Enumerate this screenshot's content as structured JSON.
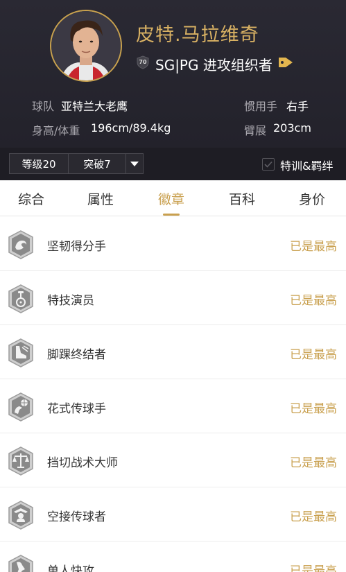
{
  "player": {
    "name": "皮特.马拉维奇",
    "overall": "70",
    "position_role": "SG|PG 进攻组织者"
  },
  "info": {
    "team_label": "球队",
    "team_value": "亚特兰大老鹰",
    "hand_label": "惯用手",
    "hand_value": "右手",
    "height_weight_label": "身高/体重",
    "height_weight_value": "196cm/89.4kg",
    "wingspan_label": "臂展",
    "wingspan_value": "203cm"
  },
  "controls": {
    "level": "等级20",
    "breakthrough": "突破7",
    "training_label": "特训&羁绊"
  },
  "tabs": [
    {
      "label": "综合"
    },
    {
      "label": "属性"
    },
    {
      "label": "徽章"
    },
    {
      "label": "百科"
    },
    {
      "label": "身价"
    }
  ],
  "active_tab": "徽章",
  "badges": [
    {
      "name": "坚韧得分手",
      "status": "已是最高",
      "icon": "tough-scorer-icon"
    },
    {
      "name": "特技演员",
      "status": "已是最高",
      "icon": "unicycle-icon"
    },
    {
      "name": "脚踝终结者",
      "status": "已是最高",
      "icon": "ankle-breaker-icon"
    },
    {
      "name": "花式传球手",
      "status": "已是最高",
      "icon": "flashy-passer-icon"
    },
    {
      "name": "挡切战术大师",
      "status": "已是最高",
      "icon": "pick-and-roll-icon"
    },
    {
      "name": "空接传球者",
      "status": "已是最高",
      "icon": "alley-oop-icon"
    },
    {
      "name": "单人快攻",
      "status": "已是最高",
      "icon": "fast-break-icon"
    }
  ],
  "colors": {
    "header_bg": "#26252e",
    "gold": "#c9a04f",
    "name_gold": "#d8b163"
  }
}
